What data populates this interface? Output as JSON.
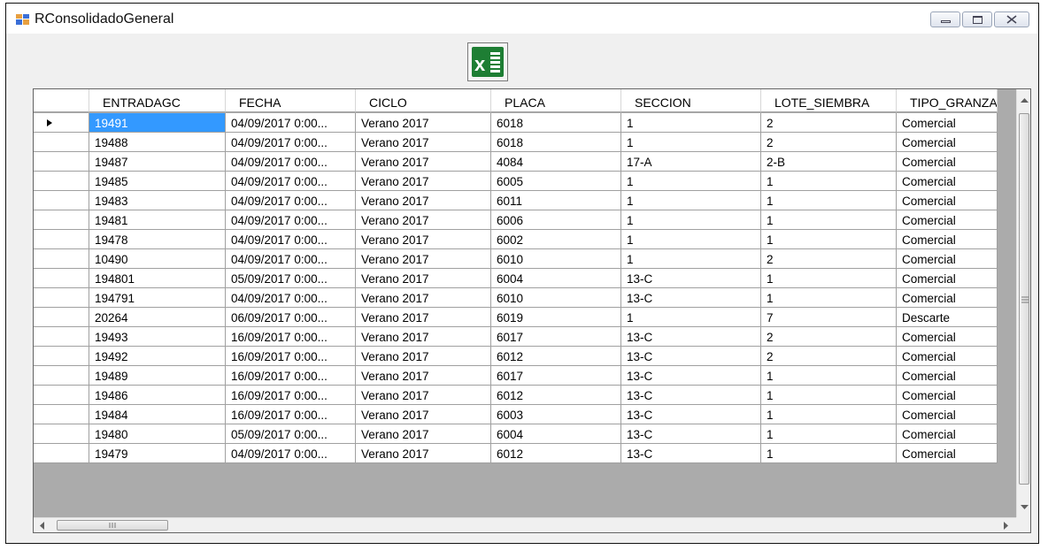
{
  "window": {
    "title": "RConsolidadoGeneral"
  },
  "toolbar": {
    "export_icon": "excel-icon",
    "export_letter": "x"
  },
  "grid": {
    "columns": [
      "ENTRADAGC",
      "FECHA",
      "CICLO",
      "PLACA",
      "SECCION",
      "LOTE_SIEMBRA",
      "TIPO_GRANZA"
    ],
    "rows": [
      [
        "19491",
        "04/09/2017 0:00...",
        "Verano 2017",
        "6018",
        "1",
        "2",
        "Comercial"
      ],
      [
        "19488",
        "04/09/2017 0:00...",
        "Verano 2017",
        "6018",
        "1",
        "2",
        "Comercial"
      ],
      [
        "19487",
        "04/09/2017 0:00...",
        "Verano 2017",
        "4084",
        "17-A",
        "2-B",
        "Comercial"
      ],
      [
        "19485",
        "04/09/2017 0:00...",
        "Verano 2017",
        "6005",
        "1",
        "1",
        "Comercial"
      ],
      [
        "19483",
        "04/09/2017 0:00...",
        "Verano 2017",
        "6011",
        "1",
        "1",
        "Comercial"
      ],
      [
        "19481",
        "04/09/2017 0:00...",
        "Verano 2017",
        "6006",
        "1",
        "1",
        "Comercial"
      ],
      [
        "19478",
        "04/09/2017 0:00...",
        "Verano 2017",
        "6002",
        "1",
        "1",
        "Comercial"
      ],
      [
        "10490",
        "04/09/2017 0:00...",
        "Verano 2017",
        "6010",
        "1",
        "2",
        "Comercial"
      ],
      [
        "194801",
        "05/09/2017 0:00...",
        "Verano 2017",
        "6004",
        "13-C",
        "1",
        "Comercial"
      ],
      [
        "194791",
        "04/09/2017 0:00...",
        "Verano 2017",
        "6010",
        "13-C",
        "1",
        "Comercial"
      ],
      [
        "20264",
        "06/09/2017 0:00...",
        "Verano 2017",
        "6019",
        "1",
        "7",
        "Descarte"
      ],
      [
        "19493",
        "16/09/2017 0:00...",
        "Verano 2017",
        "6017",
        "13-C",
        "2",
        "Comercial"
      ],
      [
        "19492",
        "16/09/2017 0:00...",
        "Verano 2017",
        "6012",
        "13-C",
        "2",
        "Comercial"
      ],
      [
        "19489",
        "16/09/2017 0:00...",
        "Verano 2017",
        "6017",
        "13-C",
        "1",
        "Comercial"
      ],
      [
        "19486",
        "16/09/2017 0:00...",
        "Verano 2017",
        "6012",
        "13-C",
        "1",
        "Comercial"
      ],
      [
        "19484",
        "16/09/2017 0:00...",
        "Verano 2017",
        "6003",
        "13-C",
        "1",
        "Comercial"
      ],
      [
        "19480",
        "05/09/2017 0:00...",
        "Verano 2017",
        "6004",
        "13-C",
        "1",
        "Comercial"
      ],
      [
        "19479",
        "04/09/2017 0:00...",
        "Verano 2017",
        "6012",
        "13-C",
        "1",
        "Comercial"
      ]
    ],
    "selected_row": 0,
    "colors": {
      "selection": "#3399ff",
      "excel_green": "#1e7e34"
    }
  }
}
